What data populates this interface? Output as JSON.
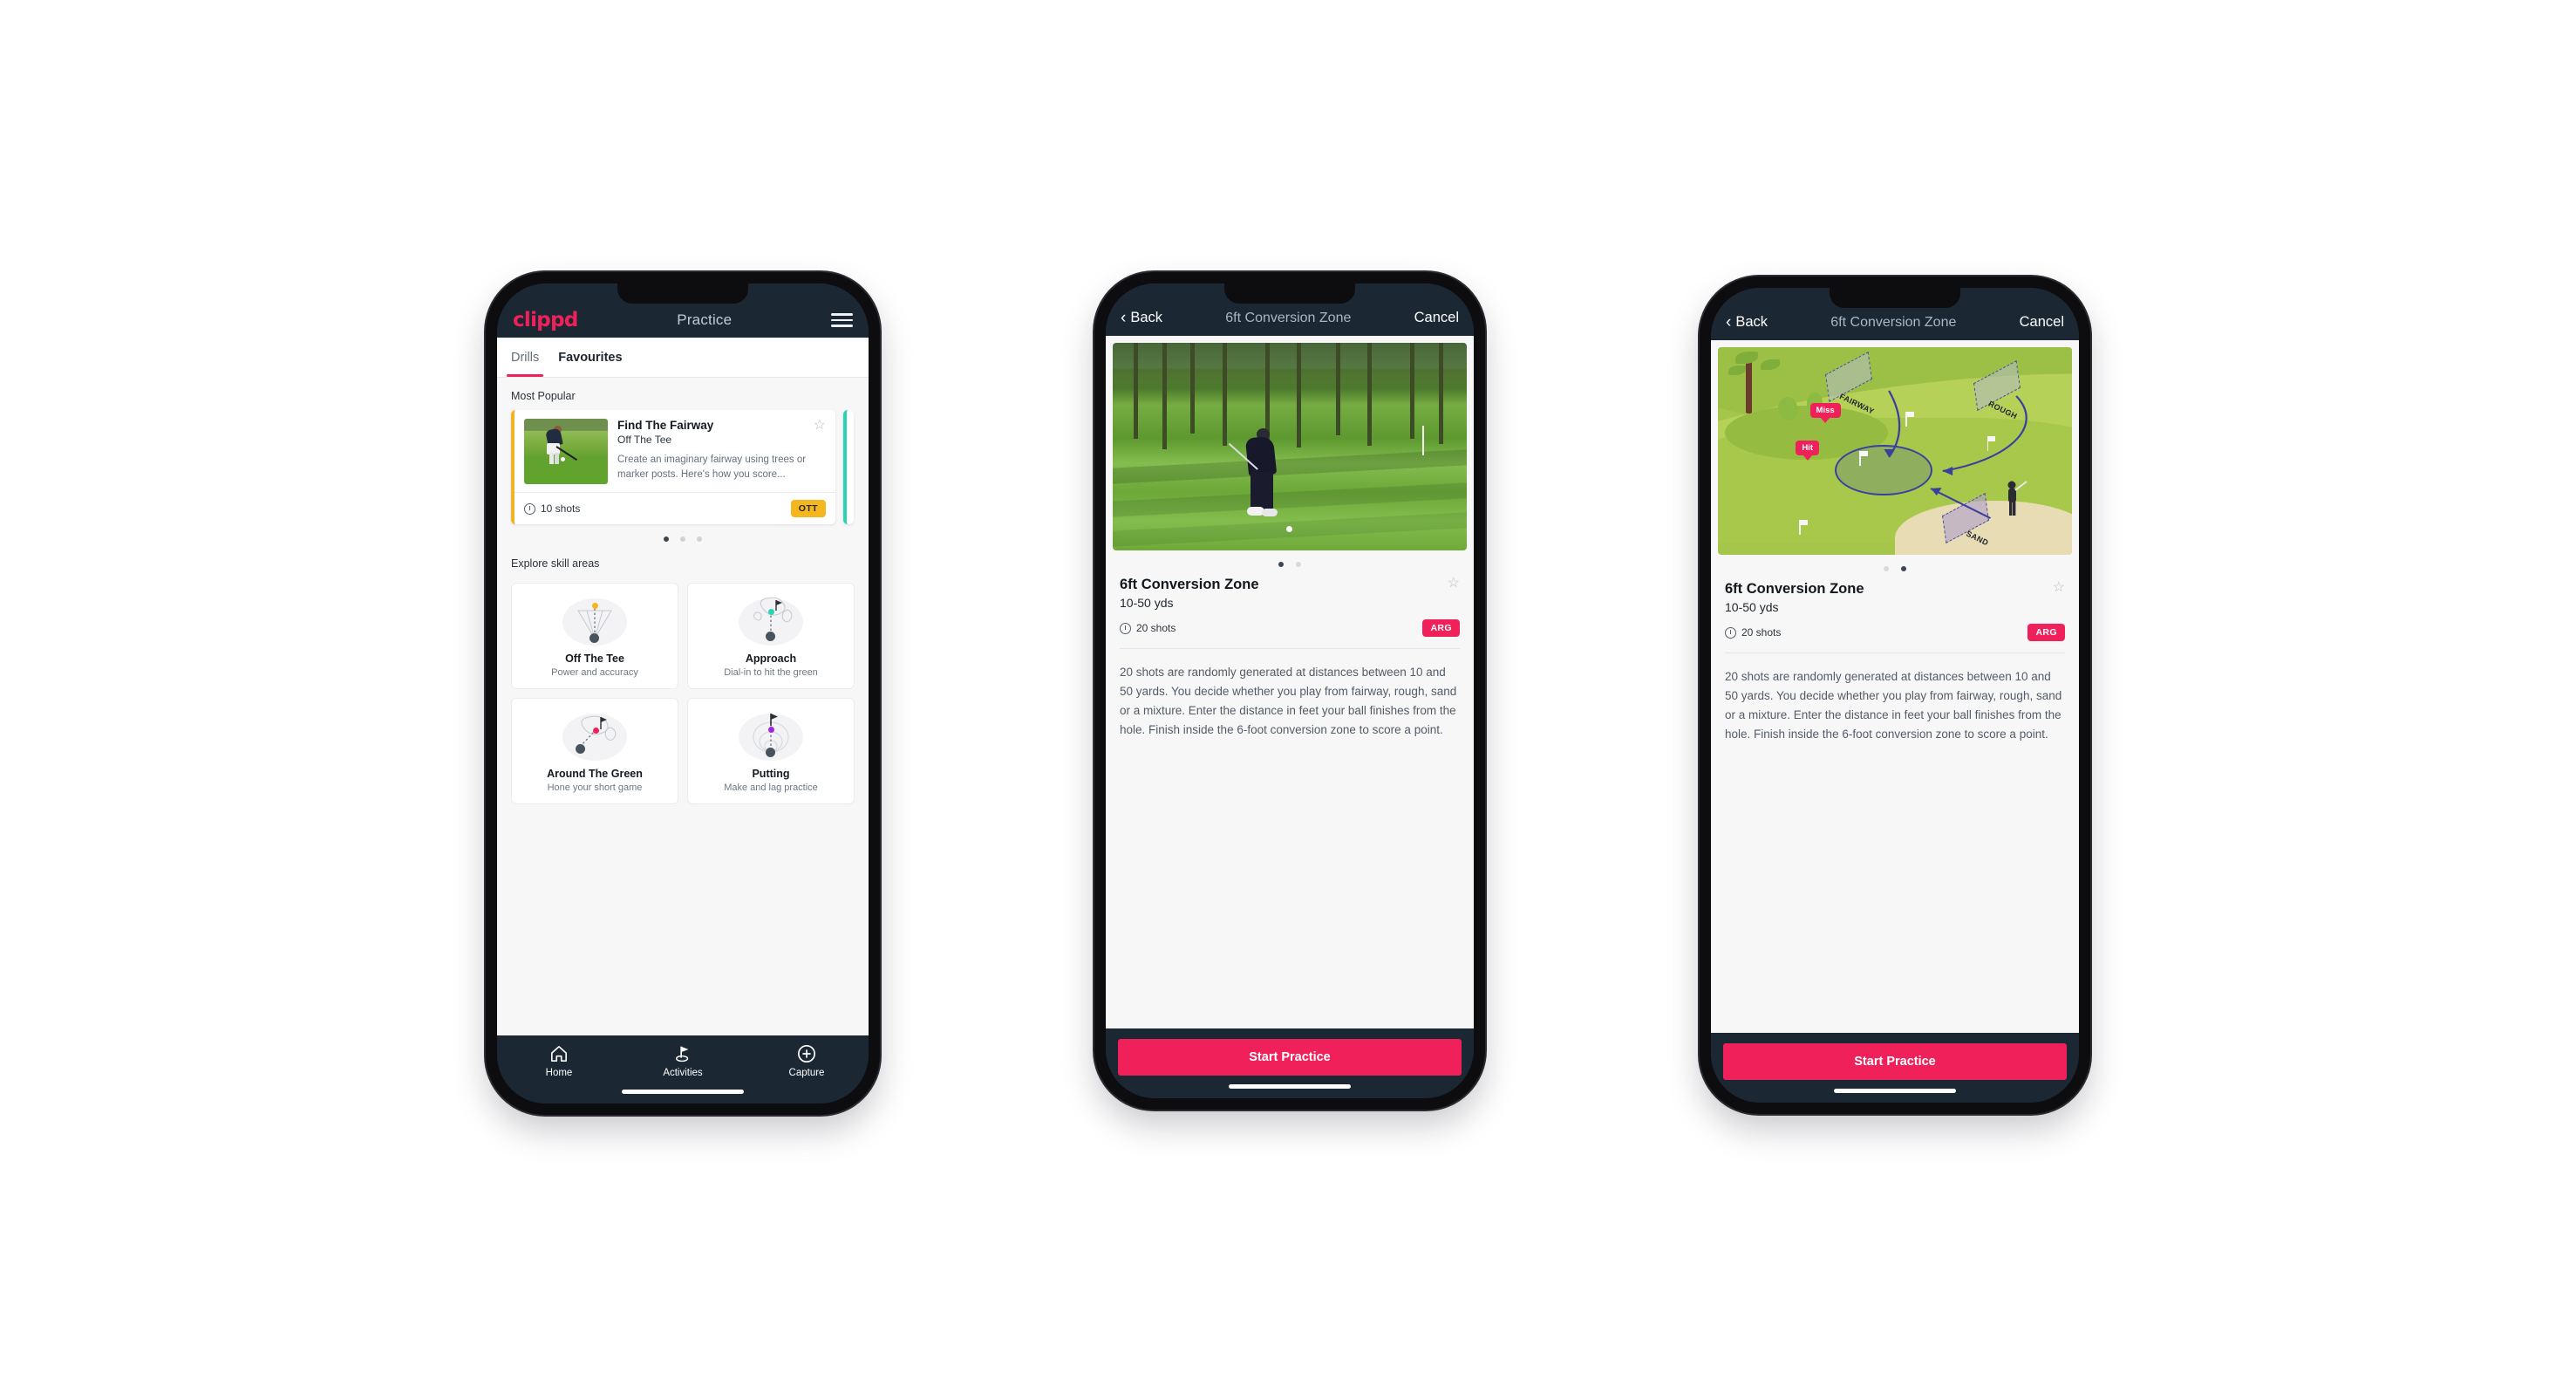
{
  "colors": {
    "brand_pink": "#f0215a",
    "dark_navy": "#1b2733",
    "badge_ott": "#f5b71f",
    "badge_arg": "#f0215a",
    "teal_accent": "#2ad3b4"
  },
  "phone1": {
    "appbar": {
      "logo": "clippd",
      "title": "Practice",
      "menu_icon": "hamburger-menu-icon"
    },
    "tabs": [
      {
        "label": "Drills",
        "active": true
      },
      {
        "label": "Favourites",
        "active": false
      }
    ],
    "most_popular": {
      "section_label": "Most Popular",
      "card": {
        "title": "Find The Fairway",
        "subtitle": "Off The Tee",
        "description": "Create an imaginary fairway using trees or marker posts. Here's how you score...",
        "shots": "10 shots",
        "badge": "OTT",
        "favourite_icon": "star-outline-icon"
      },
      "dots": {
        "count": 3,
        "active": 0
      }
    },
    "explore": {
      "section_label": "Explore skill areas",
      "cards": [
        {
          "name": "Off The Tee",
          "desc": "Power and accuracy",
          "accent": "#f5b71f"
        },
        {
          "name": "Approach",
          "desc": "Dial-in to hit the green",
          "accent": "#2ad3b4"
        },
        {
          "name": "Around The Green",
          "desc": "Hone your short game",
          "accent": "#f0215a"
        },
        {
          "name": "Putting",
          "desc": "Make and lag practice",
          "accent": "#a227d6"
        }
      ]
    },
    "tabbar": [
      {
        "label": "Home",
        "icon": "home-icon",
        "active": false
      },
      {
        "label": "Activities",
        "icon": "golf-flag-icon",
        "active": true
      },
      {
        "label": "Capture",
        "icon": "plus-circle-icon",
        "active": false
      }
    ]
  },
  "phone2": {
    "navbar": {
      "back": "Back",
      "title": "6ft Conversion Zone",
      "cancel": "Cancel"
    },
    "media_type": "photo",
    "dots": {
      "count": 2,
      "active": 0
    },
    "detail": {
      "title": "6ft Conversion Zone",
      "yards": "10-50 yds",
      "shots": "20 shots",
      "badge": "ARG",
      "favourite_icon": "star-outline-icon",
      "description": "20 shots are randomly generated at distances between 10 and 50 yards. You decide whether you play from fairway, rough, sand or a mixture. Enter the distance in feet your ball finishes from the hole. Finish inside the 6-foot conversion zone to score a point."
    },
    "cta": "Start Practice"
  },
  "phone3": {
    "navbar": {
      "back": "Back",
      "title": "6ft Conversion Zone",
      "cancel": "Cancel"
    },
    "media_type": "illustration",
    "illustration": {
      "zones": [
        "FAIRWAY",
        "ROUGH",
        "SAND"
      ],
      "pins": [
        "Miss",
        "Hit"
      ]
    },
    "dots": {
      "count": 2,
      "active": 1
    },
    "detail": {
      "title": "6ft Conversion Zone",
      "yards": "10-50 yds",
      "shots": "20 shots",
      "badge": "ARG",
      "favourite_icon": "star-outline-icon",
      "description": "20 shots are randomly generated at distances between 10 and 50 yards. You decide whether you play from fairway, rough, sand or a mixture. Enter the distance in feet your ball finishes from the hole. Finish inside the 6-foot conversion zone to score a point."
    },
    "cta": "Start Practice"
  }
}
